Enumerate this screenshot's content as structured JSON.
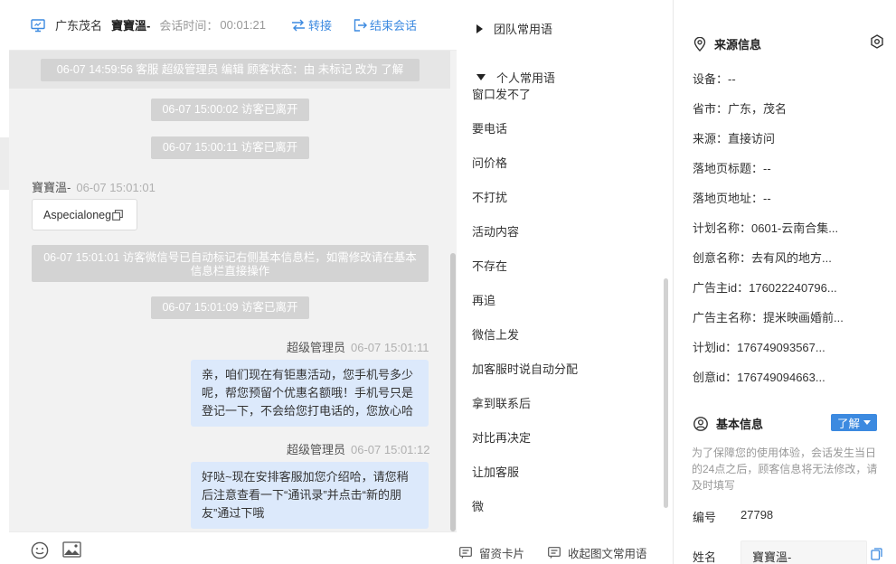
{
  "header": {
    "region": "广东茂名",
    "visitor_name": "寶寶溫-",
    "timer_label": "会话时间：",
    "timer_value": "00:01:21",
    "transfer_label": "转接",
    "end_label": "结束会话"
  },
  "messages": {
    "system_1": "06-07 14:59:56 客服 超级管理员 编辑 顾客状态：由 未标记 改为 了解",
    "system_2": "06-07 15:00:02 访客已离开",
    "system_3": "06-07 15:00:11 访客已离开",
    "visitor_sender": "寶寶溫-",
    "visitor_time": "06-07 15:01:01",
    "visitor_card": "Aspecialoneg",
    "system_4": "06-07 15:01:01 访客微信号已自动标记右侧基本信息栏，如需修改请在基本信息栏直接操作",
    "system_5": "06-07 15:01:09 访客已离开",
    "agent_sender_1": "超级管理员",
    "agent_time_1": "06-07 15:01:11",
    "agent_msg_1": "亲，咱们现在有钜惠活动，您手机号多少呢，帮您预留个优惠名额哦！手机号只是登记一下，不会给您打电话的，您放心哈",
    "agent_sender_2": "超级管理员",
    "agent_time_2": "06-07 15:01:12",
    "agent_msg_2": "好哒~现在安排客服加您介绍哈，请您稍后注意查看一下“通讯录”并点击“新的朋友”通过下哦"
  },
  "phrases": {
    "team_group": "团队常用语",
    "personal_group": "个人常用语",
    "items": [
      "窗口发不了",
      "要电话",
      "问价格",
      "不打扰",
      "活动内容",
      "不存在",
      "再追",
      "微信上发",
      "加客服时说自动分配",
      "拿到联系后",
      "对比再决定",
      "让加客服",
      "微"
    ],
    "footer_card": "留资卡片",
    "footer_collapse": "收起图文常用语"
  },
  "source_info": {
    "title": "来源信息",
    "rows": [
      "设备：--",
      "省市：广东，茂名",
      "来源：直接访问",
      "落地页标题：--",
      "落地页地址：--",
      "计划名称：0601-云南合集...",
      "创意名称：去有风的地方...",
      "广告主id：176022240796...",
      "广告主名称：提米映画婚前...",
      "计划id：176749093567...",
      "创意id：176749094663..."
    ]
  },
  "basic_info": {
    "title": "基本信息",
    "status_button": "了解",
    "notice": "为了保障您的使用体验，会话发生当日的24点之后，顾客信息将无法修改，请及时填写",
    "id_label": "编号",
    "id_value": "27798",
    "name_label": "姓名",
    "name_value": "寶寶溫-"
  },
  "colors": {
    "accent": "#3c8ae0",
    "bubble": "#dce9fb",
    "system_pill": "#d3d3d3"
  }
}
